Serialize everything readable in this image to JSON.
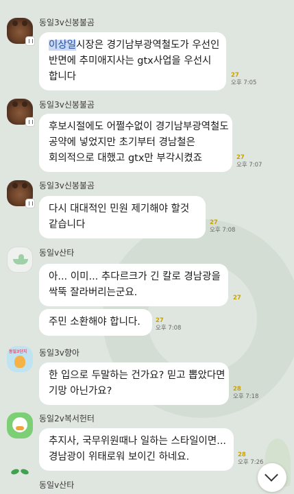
{
  "messages": [
    {
      "sender": "동일3v신봉불곰",
      "highlight": "이상일",
      "lines": [
        "시장은 경기남부광역철도가 우선인",
        "반면에  추미애지사는 gtx사업을 우선시",
        "합니다"
      ],
      "unread": "27",
      "time": "오후 7:05"
    },
    {
      "sender": "동일3v신봉불곰",
      "lines": [
        "후보시절에도 어쩔수없이 경기남부광역철도",
        "공약에 넣었지만 초기부터 경남철은",
        "회의적으로 대했고 gtx만 부각시켰죠"
      ],
      "unread": "27",
      "time": "오후 7:07"
    },
    {
      "sender": "동일3v신봉불곰",
      "lines": [
        "다시 대대적인 민원 제기해야 할것",
        "같습니다"
      ],
      "unread": "27",
      "time": "오후 7:08"
    },
    {
      "sender": "동일v산타",
      "lines": [
        "아... 이미... 추다르크가 긴 칼로 경남광을",
        "싹뚝 잘라버리는군요."
      ],
      "unread": "27",
      "time": ""
    },
    {
      "sender": "",
      "lines": [
        "주민 소환해야 합니다."
      ],
      "unread": "27",
      "time": "오후 7:08"
    },
    {
      "sender": "동일3v향아",
      "lines": [
        "한 입으로 두말하는 건가요? 믿고 뽑았다면",
        "기망 아닌가요?"
      ],
      "unread": "28",
      "time": "오후 7:18"
    },
    {
      "sender": "동일2v복서헌터",
      "lines": [
        "추지사, 국무위원때나 일하는 스타일이면...",
        "경남광이 위태로워 보이긴 하네요."
      ],
      "unread": "28",
      "time": "오후 7:26"
    },
    {
      "sender": "동일v산타",
      "lines": [],
      "unread": "",
      "time": ""
    }
  ],
  "icons": {
    "avatar_bear": "brown-bear-avatar",
    "avatar_ship": "santa-ship-avatar",
    "avatar_kid": "dongil3danji-avatar",
    "avatar_duck": "duck-avatar",
    "avatar_sprout": "sprout-avatar",
    "profile_badge": "profile-badge-icon",
    "scroll_down": "chevron-down-icon"
  },
  "colors": {
    "background": "#dfe5df",
    "bubble": "#ffffff",
    "unread": "#c9a400",
    "highlight": "#c8daf5"
  }
}
